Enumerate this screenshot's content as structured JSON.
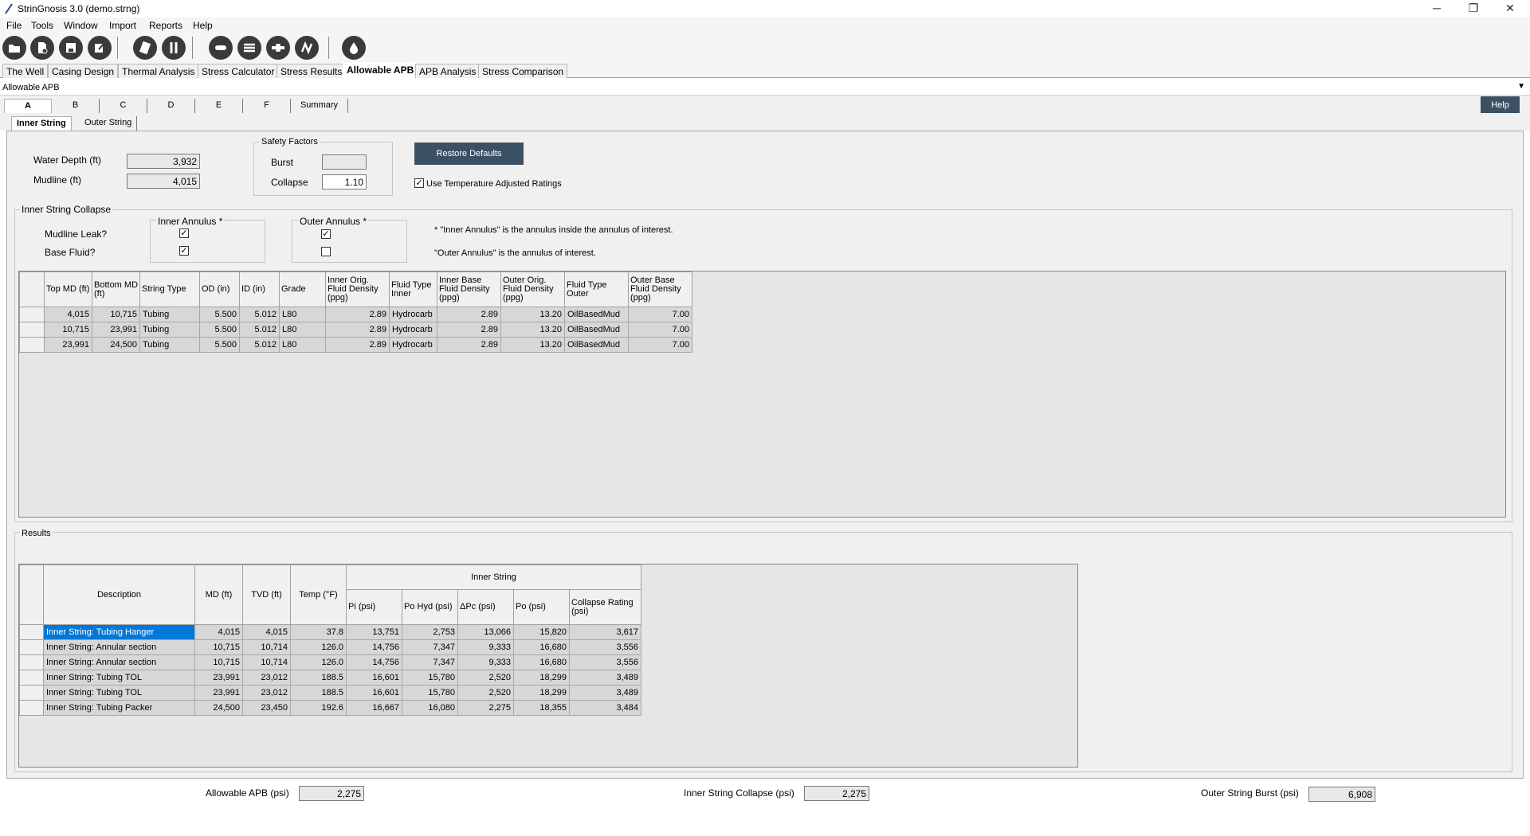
{
  "window": {
    "title": "StrinGnosis 3.0 (demo.strng)",
    "minimize_glyph": "─",
    "restore_glyph": "❐",
    "close_glyph": "✕"
  },
  "menu": [
    "File",
    "Tools",
    "Window",
    "Import",
    "Reports",
    "Help"
  ],
  "toolbar_icons": [
    "open-folder-icon",
    "new-file-icon",
    "save-icon",
    "edit-icon",
    "calculator-icon",
    "tools-icon",
    "pipe-icon",
    "stack-icon",
    "connector-icon",
    "spring-icon",
    "drop-icon"
  ],
  "main_tabs": [
    "The Well",
    "Casing Design",
    "Thermal Analysis",
    "Stress Calculator",
    "Stress Results",
    "Allowable APB",
    "APB Analysis",
    "Stress Comparison"
  ],
  "main_tab_active": "Allowable APB",
  "combo": {
    "value": "Allowable APB",
    "arrow": "▼"
  },
  "sub_tabs": [
    "A",
    "B",
    "C",
    "D",
    "E",
    "F",
    "Summary"
  ],
  "help_label": "Help",
  "inner_tabs": [
    "Inner String",
    "Outer String"
  ],
  "well": {
    "water_depth_label": "Water Depth (ft)",
    "water_depth": "3,932",
    "mudline_label": "Mudline (ft)",
    "mudline": "4,015"
  },
  "safety_factors": {
    "title": "Safety Factors",
    "burst_label": "Burst",
    "burst": "",
    "collapse_label": "Collapse",
    "collapse": "1.10"
  },
  "restore_defaults_label": "Restore Defaults",
  "use_temp_label": "Use Temperature Adjusted Ratings",
  "check_mark": "✓",
  "collapse_group": {
    "title": "Inner String Collapse",
    "mudline_leak_label": "Mudline Leak?",
    "base_fluid_label": "Base Fluid?",
    "inner_annulus_title": "Inner Annulus *",
    "outer_annulus_title": "Outer Annulus *",
    "note1": "* \"Inner Annulus\" is the annulus inside the annulus of interest.",
    "note2": "\"Outer Annulus\" is the annulus of interest.",
    "inner_mudline_leak": true,
    "inner_base_fluid": true,
    "outer_mudline_leak": true,
    "outer_base_fluid": false
  },
  "strings_table": {
    "headers": [
      "Top MD (ft)",
      "Bottom MD (ft)",
      "String Type",
      "OD (in)",
      "ID (in)",
      "Grade",
      "Inner Orig. Fluid Density (ppg)",
      "Fluid Type Inner",
      "Inner Base Fluid Density (ppg)",
      "Outer Orig. Fluid Density (ppg)",
      "Fluid Type Outer",
      "Outer Base Fluid Density (ppg)"
    ],
    "rows": [
      [
        "4,015",
        "10,715",
        "Tubing",
        "5.500",
        "5.012",
        "L80",
        "2.89",
        "Hydrocarb",
        "2.89",
        "13.20",
        "OilBasedMud",
        "7.00"
      ],
      [
        "10,715",
        "23,991",
        "Tubing",
        "5.500",
        "5.012",
        "L80",
        "2.89",
        "Hydrocarb",
        "2.89",
        "13.20",
        "OilBasedMud",
        "7.00"
      ],
      [
        "23,991",
        "24,500",
        "Tubing",
        "5.500",
        "5.012",
        "L80",
        "2.89",
        "Hydrocarb",
        "2.89",
        "13.20",
        "OilBasedMud",
        "7.00"
      ]
    ]
  },
  "results": {
    "title": "Results",
    "group_header": "Inner String",
    "headers": [
      "Description",
      "MD (ft)",
      "TVD (ft)",
      "Temp (°F)",
      "Pi (psi)",
      "Po Hyd (psi)",
      "ΔPc (psi)",
      "Po (psi)",
      "Collapse Rating (psi)"
    ],
    "rows": [
      [
        "Inner String: Tubing Hanger",
        "4,015",
        "4,015",
        "37.8",
        "13,751",
        "2,753",
        "13,066",
        "15,820",
        "3,617"
      ],
      [
        "Inner String:  Annular section",
        "10,715",
        "10,714",
        "126.0",
        "14,756",
        "7,347",
        "9,333",
        "16,680",
        "3,556"
      ],
      [
        "Inner String:  Annular section",
        "10,715",
        "10,714",
        "126.0",
        "14,756",
        "7,347",
        "9,333",
        "16,680",
        "3,556"
      ],
      [
        "Inner String: Tubing TOL",
        "23,991",
        "23,012",
        "188.5",
        "16,601",
        "15,780",
        "2,520",
        "18,299",
        "3,489"
      ],
      [
        "Inner String: Tubing TOL",
        "23,991",
        "23,012",
        "188.5",
        "16,601",
        "15,780",
        "2,520",
        "18,299",
        "3,489"
      ],
      [
        "Inner String: Tubing Packer",
        "24,500",
        "23,450",
        "192.6",
        "16,667",
        "16,080",
        "2,275",
        "18,355",
        "3,484"
      ]
    ]
  },
  "footer": {
    "allowable_apb_label": "Allowable APB (psi)",
    "allowable_apb": "2,275",
    "inner_collapse_label": "Inner String Collapse (psi)",
    "inner_collapse": "2,275",
    "outer_burst_label": "Outer String Burst (psi)",
    "outer_burst": "6,908"
  }
}
